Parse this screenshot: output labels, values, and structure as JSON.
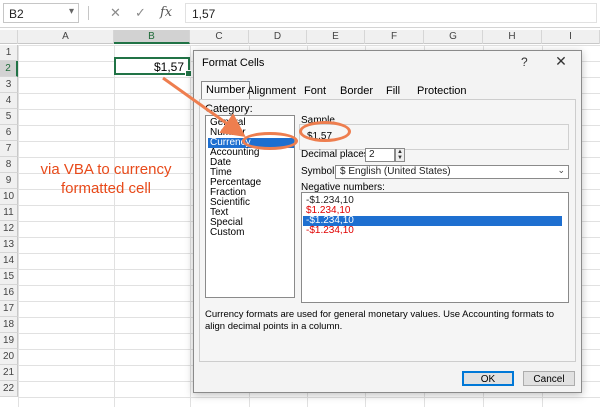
{
  "formula_bar": {
    "name_box": "B2",
    "name_box_dropdown": "▾",
    "cancel_icon": "✕",
    "enter_icon": "✓",
    "fx_label": "fx",
    "formula_value": "1,57"
  },
  "sheet": {
    "columns": [
      "A",
      "B",
      "C",
      "D",
      "E",
      "F",
      "G",
      "H",
      "I"
    ],
    "rows": [
      "1",
      "2",
      "3",
      "4",
      "5",
      "6",
      "7",
      "8",
      "9",
      "10",
      "11",
      "12",
      "13",
      "14",
      "15",
      "16",
      "17",
      "18",
      "19",
      "20",
      "21",
      "22"
    ],
    "selected_cell_value": "$1,57",
    "annotation_line1": "via VBA to currency",
    "annotation_line2": "formatted cell",
    "annotation_color": "#e84a1a"
  },
  "dialog": {
    "title": "Format Cells",
    "help": "?",
    "close": "✕",
    "tabs": [
      "Number",
      "Alignment",
      "Font",
      "Border",
      "Fill",
      "Protection"
    ],
    "category_label": "Category:",
    "categories": [
      "General",
      "Number",
      "Currency",
      "Accounting",
      "Date",
      "Time",
      "Percentage",
      "Fraction",
      "Scientific",
      "Text",
      "Special",
      "Custom"
    ],
    "selected_category": "Currency",
    "sample_label": "Sample",
    "sample_value": "$1,57",
    "decimal_label": "Decimal places:",
    "decimal_value": "2",
    "symbol_label": "Symbol:",
    "symbol_value": "$ English (United States)",
    "negative_label": "Negative numbers:",
    "negative_numbers": [
      {
        "text": "-$1.234,10",
        "red": false
      },
      {
        "text": "$1.234,10",
        "red": true
      },
      {
        "text": "-$1.234,10",
        "red": false
      },
      {
        "text": "-$1.234,10",
        "red": true
      }
    ],
    "selected_negative_index": 2,
    "description": "Currency formats are used for general monetary values.  Use Accounting formats to align decimal points in a column.",
    "ok": "OK",
    "cancel": "Cancel",
    "highlight_color": "#ee7e4f",
    "selection_color": "#1e6fd0"
  }
}
